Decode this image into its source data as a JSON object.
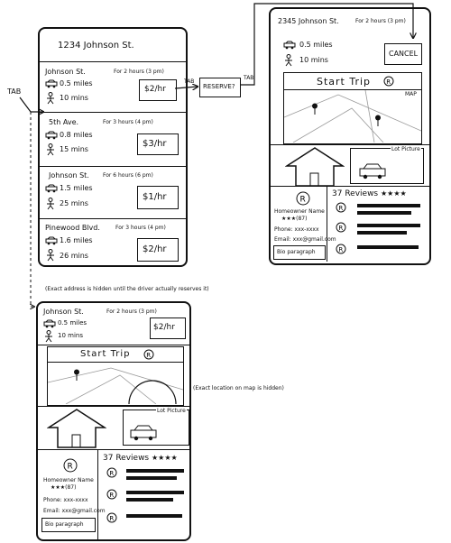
{
  "screen1": {
    "header": "1234   Johnson St.",
    "listings": [
      {
        "street": "Johnson St.",
        "duration": "For 2 hours (3 pm)",
        "distance": "0.5 miles",
        "walk": "10 mins",
        "price": "$2/hr"
      },
      {
        "street": "5th Ave.",
        "duration": "For 3 hours (4 pm)",
        "distance": "0.8 miles",
        "walk": "15 mins",
        "price": "$3/hr"
      },
      {
        "street": "Johnson St.",
        "duration": "For 6 hours (6 pm)",
        "distance": "1.5 miles",
        "walk": "25 mins",
        "price": "$1/hr"
      },
      {
        "street": "Pinewood Blvd.",
        "duration": "For 3 hours (4 pm)",
        "distance": "1.6 miles",
        "walk": "26 mins",
        "price": "$2/hr"
      }
    ]
  },
  "flow": {
    "tab_left": "TAB",
    "tab_mid": "TAB",
    "tab_right": "TAB",
    "reserve": "RESERVE?"
  },
  "screen2": {
    "address": "2345 Johnson St.",
    "duration": "For 2 hours (3 pm)",
    "distance": "0.5 miles",
    "walk": "10 mins",
    "cancel": "CANCEL",
    "start_trip": "Start Trip",
    "map_label": "MAP",
    "lot_picture": "Lot Picture",
    "reviews": "37 Reviews",
    "reviews_stars": "★★★★",
    "owner_name": "Homeowner Name",
    "owner_rating": "★★★(87)",
    "phone": "Phone: xxx-xxxx",
    "email": "Email: xxx@gmail.com",
    "bio": "Bio paragraph"
  },
  "note_address": "(Exact address is hidden until the driver actually reserves it)",
  "note_map": "(Exact location on map is hidden)",
  "screen3": {
    "street": "Johnson St.",
    "duration": "For 2 hours (3 pm)",
    "distance": "0.5 miles",
    "walk": "10 mins",
    "price": "$2/hr",
    "start_trip": "Start Trip",
    "lot_picture": "Lot Picture",
    "reviews": "37 Reviews",
    "reviews_stars": "★★★★",
    "owner_name": "Homeowner Name",
    "owner_rating": "★★★(87)",
    "phone": "Phone: xxx-xxxx",
    "email": "Email: xxx@gmail.com",
    "bio": "Bio paragraph"
  }
}
